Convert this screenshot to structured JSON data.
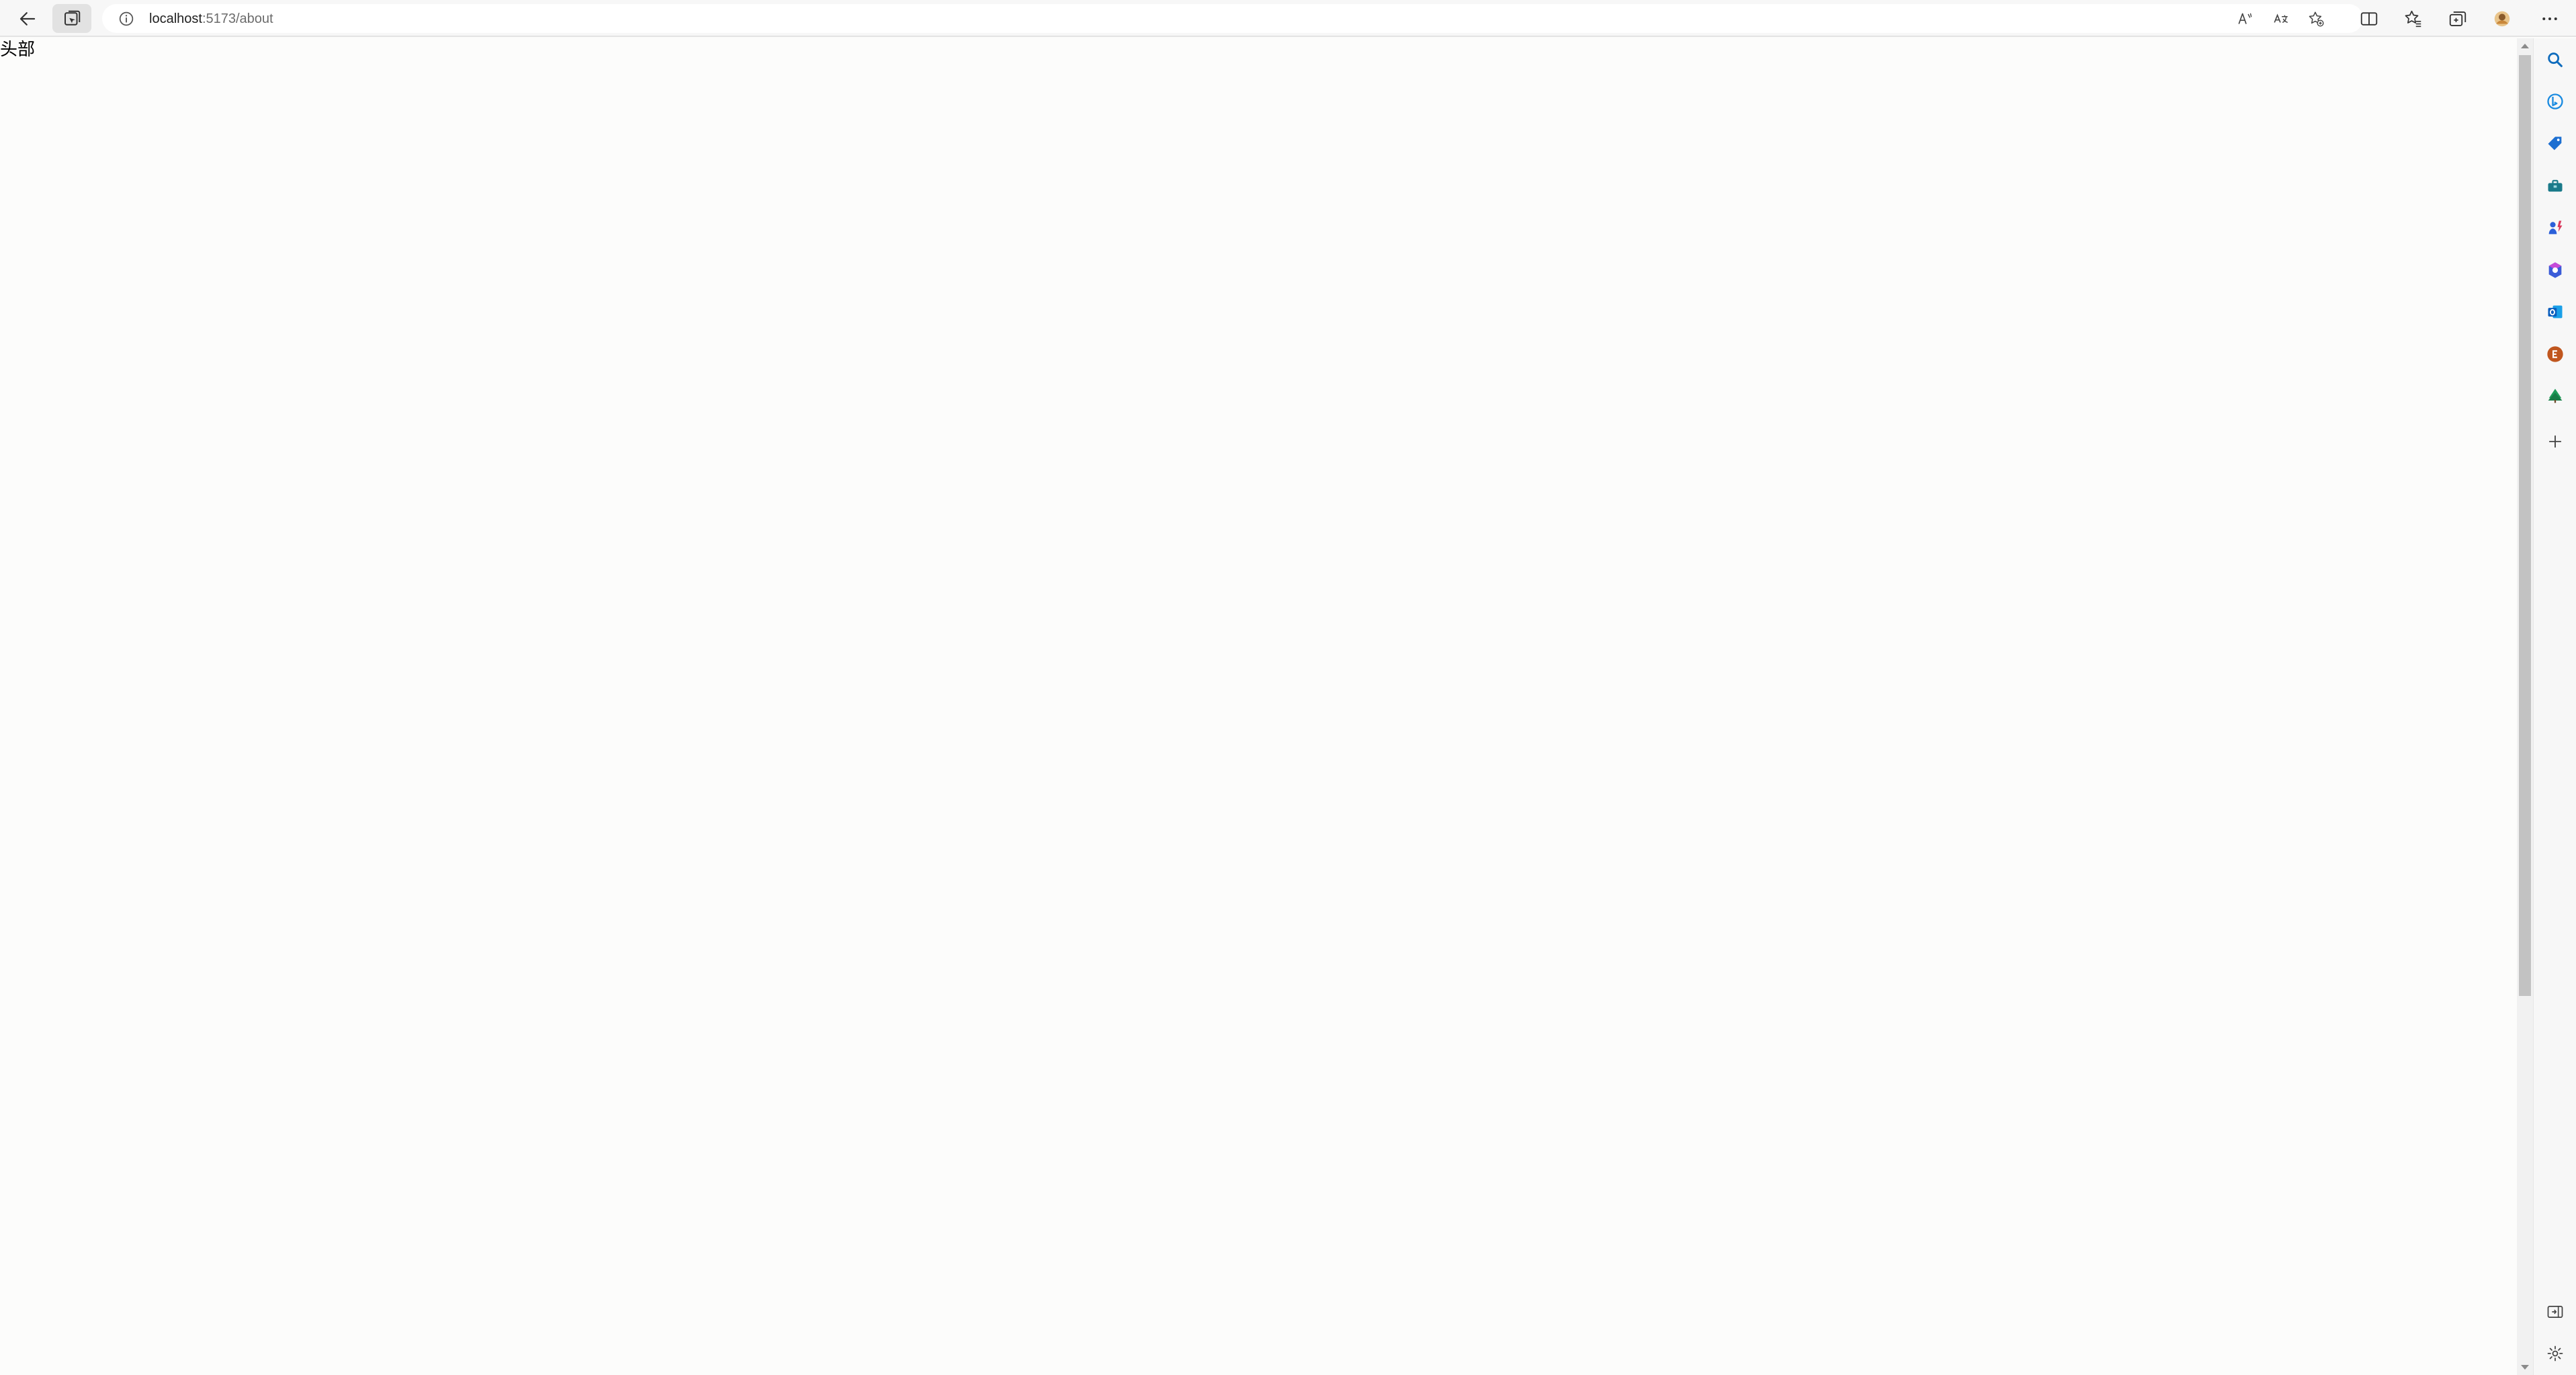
{
  "browser": {
    "address": {
      "host": "localhost",
      "port_path": ":5173/about"
    },
    "toolbar_icons": [
      "back-arrow-icon",
      "tab-actions-icon",
      "site-info-icon",
      "read-aloud-icon",
      "translate-icon",
      "add-favorite-icon",
      "split-screen-icon",
      "favorites-icon",
      "collections-icon",
      "profile-avatar",
      "more-options-icon"
    ],
    "sidebar_icons": [
      "search-icon",
      "bing-icon",
      "shopping-icon",
      "tools-icon",
      "games-icon",
      "microsoft-365-icon",
      "outlook-icon",
      "e-icon",
      "tree-icon",
      "add-icon",
      "hide-sidebar-icon",
      "settings-icon"
    ],
    "colors": {
      "toolbar_bg": "#f7f7f7",
      "page_bg": "#fcfcfb",
      "accent_blue": "#0f6cbd"
    }
  },
  "page": {
    "header_text": "头部"
  }
}
